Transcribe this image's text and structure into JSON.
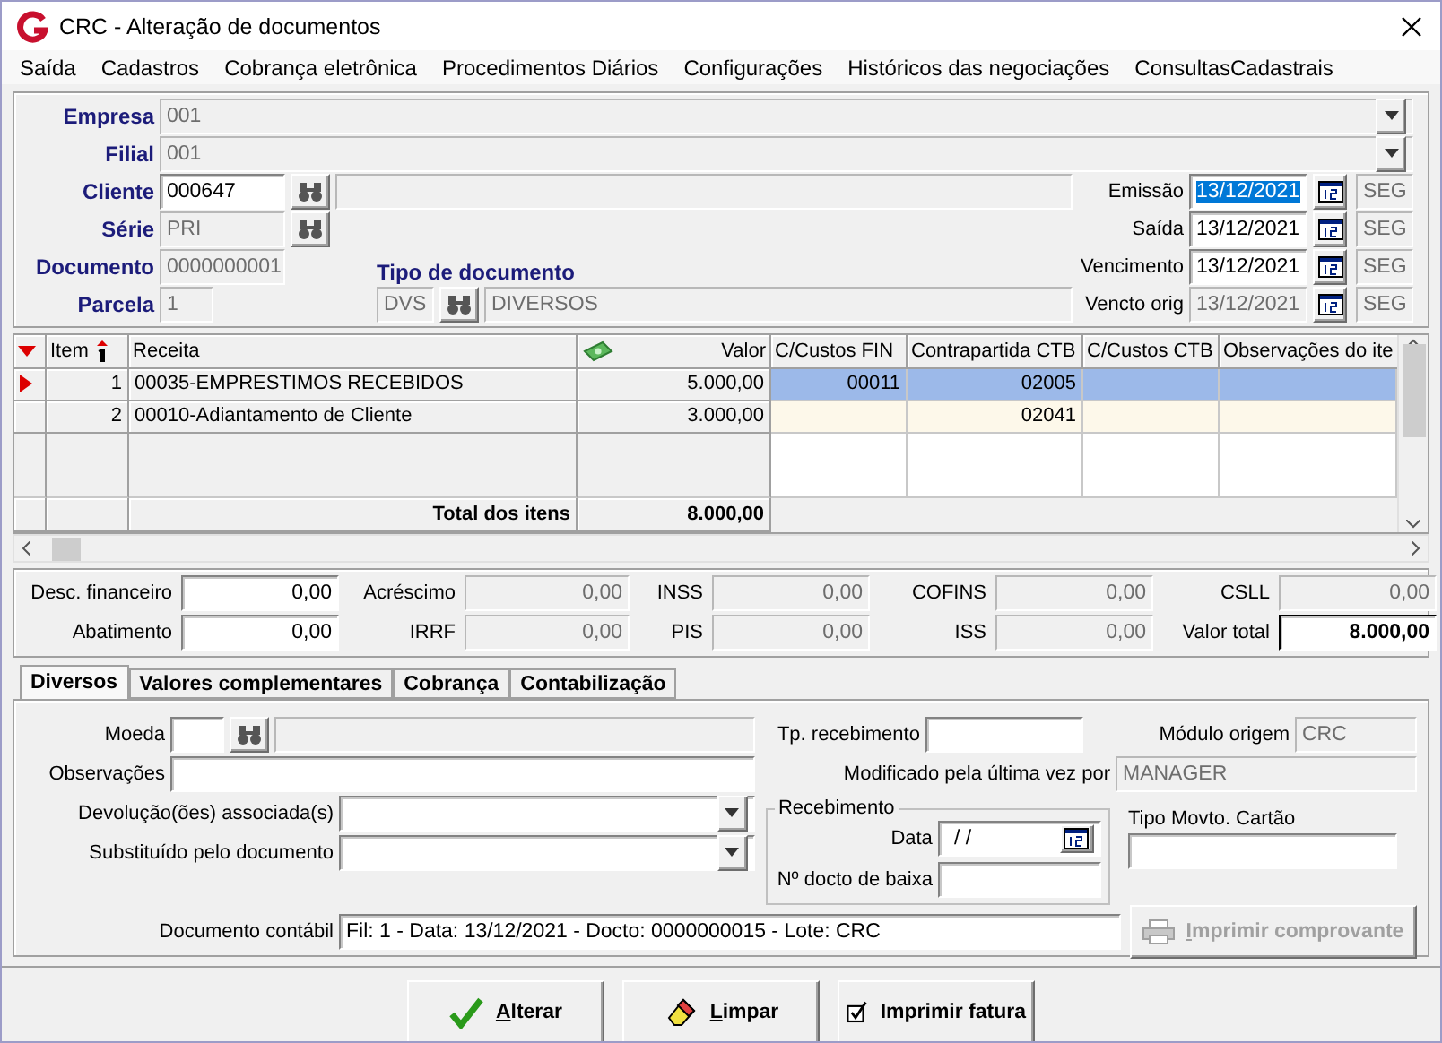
{
  "window": {
    "title": "CRC - Alteração de documentos"
  },
  "menu": [
    "Saída",
    "Cadastros",
    "Cobrança eletrônica",
    "Procedimentos Diários",
    "Configurações",
    "Históricos das negociações",
    "ConsultasCadastrais"
  ],
  "header": {
    "empresa": {
      "label": "Empresa",
      "value": "001",
      "disabled": true
    },
    "filial": {
      "label": "Filial",
      "value": "001",
      "disabled": true
    },
    "cliente": {
      "label": "Cliente",
      "value": "000647",
      "disabled": false
    },
    "serie": {
      "label": "Série",
      "value": "PRI",
      "disabled": true
    },
    "documento": {
      "label": "Documento",
      "value": "0000000001",
      "disabled": true
    },
    "parcela": {
      "label": "Parcela",
      "value": "1",
      "disabled": true
    },
    "tipo_documento": {
      "label": "Tipo de documento",
      "code": "DVS",
      "description": "DIVERSOS"
    },
    "dates": [
      {
        "label": "Emissão",
        "value": "13/12/2021",
        "weekday": "SEG",
        "selected": true,
        "disabled": false
      },
      {
        "label": "Saída",
        "value": "13/12/2021",
        "weekday": "SEG",
        "selected": false,
        "disabled": false
      },
      {
        "label": "Vencimento",
        "value": "13/12/2021",
        "weekday": "SEG",
        "selected": false,
        "disabled": false
      },
      {
        "label": "Vencto orig",
        "value": "13/12/2021",
        "weekday": "SEG",
        "selected": false,
        "disabled": true
      }
    ]
  },
  "grid": {
    "columns": [
      {
        "label": "Item",
        "kind": "sort"
      },
      {
        "label": "Receita",
        "kind": "plain"
      },
      {
        "label": "Valor",
        "kind": "money"
      },
      {
        "label": "C/Custos FIN",
        "kind": "plain"
      },
      {
        "label": "Contrapartida CTB",
        "kind": "plain"
      },
      {
        "label": "C/Custos CTB",
        "kind": "plain"
      },
      {
        "label": "Observações do ite",
        "kind": "plain"
      }
    ],
    "rows": [
      {
        "item": "1",
        "receita": "00035-EMPRESTIMOS RECEBIDOS",
        "valor": "5.000,00",
        "cc_fin": "00011",
        "contrapartida": "02005",
        "selected": true
      },
      {
        "item": "2",
        "receita": "00010-Adiantamento de Cliente",
        "valor": "3.000,00",
        "contrapartida": "02041",
        "selected": false
      }
    ],
    "total_label": "Total dos itens",
    "total_value": "8.000,00"
  },
  "totals": [
    {
      "label": "Desc. financeiro",
      "value": "0,00",
      "disabled": false,
      "kind": "amount"
    },
    {
      "label": "Acréscimo",
      "value": "0,00",
      "disabled": true,
      "kind": "amount"
    },
    {
      "label": "INSS",
      "value": "0,00",
      "disabled": true,
      "kind": "amount"
    },
    {
      "label": "COFINS",
      "value": "0,00",
      "disabled": true,
      "kind": "amount"
    },
    {
      "label": "CSLL",
      "value": "0,00",
      "disabled": true,
      "kind": "amount"
    },
    {
      "label": "Abatimento",
      "value": "0,00",
      "disabled": false,
      "kind": "amount"
    },
    {
      "label": "IRRF",
      "value": "0,00",
      "disabled": true,
      "kind": "amount"
    },
    {
      "label": "PIS",
      "value": "0,00",
      "disabled": true,
      "kind": "amount"
    },
    {
      "label": "ISS",
      "value": "0,00",
      "disabled": true,
      "kind": "amount"
    },
    {
      "label": "Valor total",
      "value": "8.000,00",
      "disabled": false,
      "kind": "total"
    }
  ],
  "tabs": [
    {
      "label": "Diversos",
      "selected": true
    },
    {
      "label": "Valores complementares",
      "selected": false
    },
    {
      "label": "Cobrança",
      "selected": false
    },
    {
      "label": "Contabilização",
      "selected": false
    }
  ],
  "diversos": {
    "moeda": {
      "label": "Moeda"
    },
    "observacoes": {
      "label": "Observações"
    },
    "devolucoes": {
      "label": "Devolução(ões) associada(s)"
    },
    "substituido": {
      "label": "Substituído pelo documento"
    },
    "tp_recebimento": {
      "label": "Tp. recebimento"
    },
    "modulo_origem": {
      "label": "Módulo origem",
      "value": "CRC"
    },
    "modificado_por": {
      "label": "Modificado pela última vez por",
      "value": "MANAGER"
    },
    "recebimento": {
      "title": "Recebimento",
      "data_label": "Data",
      "data_value": "/ /",
      "docto_label": "Nº docto de baixa"
    },
    "tipo_movto_cartao": {
      "label": "Tipo Movto. Cartão"
    },
    "documento_contabil": {
      "label": "Documento contábil",
      "value": "Fil: 1 - Data: 13/12/2021 - Docto: 0000000015 - Lote: CRC"
    },
    "imprimir_comprovante": {
      "label": "Imprimir comprovante",
      "disabled": true,
      "mnemonic": true
    }
  },
  "buttons": [
    {
      "label": "Alterar",
      "kind": "confirm",
      "mnemonic": true
    },
    {
      "label": "Limpar",
      "kind": "clear",
      "mnemonic": true
    },
    {
      "label": "Imprimir fatura",
      "kind": "print",
      "mnemonic": false
    }
  ]
}
